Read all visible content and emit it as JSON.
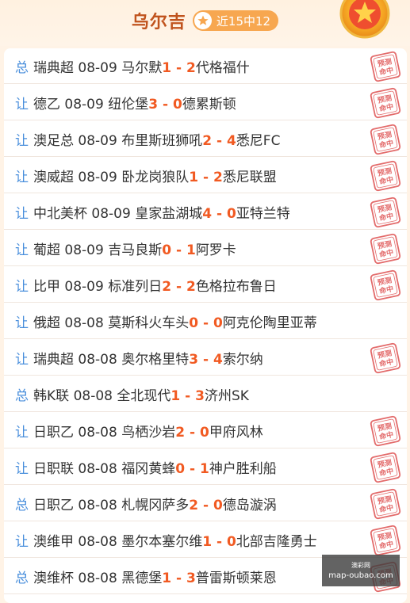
{
  "header": {
    "expert_name": "乌尔吉",
    "record": "近15中12"
  },
  "colors": {
    "bet_type": "#4a8fdc",
    "score": "#f15a22",
    "stamp": "#e36b6b",
    "name": "#c0531d",
    "badge": "#f7a750"
  },
  "icons": {
    "badge": "star-icon",
    "medal": "medal-icon",
    "stamp": "predicted-hit-stamp"
  },
  "stamp_text": {
    "line1": "预测",
    "line2": "命中"
  },
  "matches": [
    {
      "type": "总",
      "league": "瑞典超",
      "date": "08-09",
      "home": "马尔默",
      "home_score": "1",
      "sep": " - ",
      "away_score": "2",
      "away": "代格福什",
      "hit": true
    },
    {
      "type": "让",
      "league": "德乙",
      "date": "08-09",
      "home": "纽伦堡",
      "home_score": "3",
      "sep": " - ",
      "away_score": "0",
      "away": "德累斯顿",
      "hit": true
    },
    {
      "type": "让",
      "league": "澳足总",
      "date": "08-09",
      "home": "布里斯班狮吼",
      "home_score": "2",
      "sep": " - ",
      "away_score": "4",
      "away": "悉尼FC",
      "hit": true
    },
    {
      "type": "让",
      "league": "澳威超",
      "date": "08-09",
      "home": "卧龙岗狼队",
      "home_score": "1",
      "sep": " - ",
      "away_score": "2",
      "away": "悉尼联盟",
      "hit": true
    },
    {
      "type": "让",
      "league": "中北美杯",
      "date": "08-09",
      "home": "皇家盐湖城",
      "home_score": "4",
      "sep": " - ",
      "away_score": "0",
      "away": "亚特兰特",
      "hit": true
    },
    {
      "type": "让",
      "league": "葡超",
      "date": "08-09",
      "home": "吉马良斯",
      "home_score": "0",
      "sep": " - ",
      "away_score": "1",
      "away": "阿罗卡",
      "hit": true
    },
    {
      "type": "让",
      "league": "比甲",
      "date": "08-09",
      "home": "标准列日",
      "home_score": "2",
      "sep": " - ",
      "away_score": "2",
      "away": "色格拉布鲁日",
      "hit": true
    },
    {
      "type": "让",
      "league": "俄超",
      "date": "08-08",
      "home": "莫斯科火车头",
      "home_score": "0",
      "sep": " - ",
      "away_score": "0",
      "away": "阿克伦陶里亚蒂",
      "hit": false
    },
    {
      "type": "让",
      "league": "瑞典超",
      "date": "08-08",
      "home": "奥尔格里特",
      "home_score": "3",
      "sep": " - ",
      "away_score": "4",
      "away": "索尔纳",
      "hit": true
    },
    {
      "type": "总",
      "league": "韩K联",
      "date": "08-08",
      "home": "全北现代",
      "home_score": "1",
      "sep": " - ",
      "away_score": "3",
      "away": "济州SK",
      "hit": false
    },
    {
      "type": "让",
      "league": "日职乙",
      "date": "08-08",
      "home": "鸟栖沙岩",
      "home_score": "2",
      "sep": " - ",
      "away_score": "0",
      "away": "甲府风林",
      "hit": true
    },
    {
      "type": "让",
      "league": "日职联",
      "date": "08-08",
      "home": "福冈黄蜂",
      "home_score": "0",
      "sep": " - ",
      "away_score": "1",
      "away": "神户胜利船",
      "hit": true
    },
    {
      "type": "总",
      "league": "日职乙",
      "date": "08-08",
      "home": "札幌冈萨多",
      "home_score": "2",
      "sep": " - ",
      "away_score": "0",
      "away": "德岛漩涡",
      "hit": true
    },
    {
      "type": "让",
      "league": "澳维甲",
      "date": "08-08",
      "home": "墨尔本塞尔维",
      "home_score": "1",
      "sep": " - ",
      "away_score": "0",
      "away": "北部吉隆勇士",
      "hit": true
    },
    {
      "type": "总",
      "league": "澳维杯",
      "date": "08-08",
      "home": "黑德堡",
      "home_score": "1",
      "sep": " - ",
      "away_score": "3",
      "away": "普雷斯顿莱恩",
      "hit": true
    }
  ],
  "watermark": {
    "title": "澳彩网",
    "url": "map-oubao.com"
  }
}
